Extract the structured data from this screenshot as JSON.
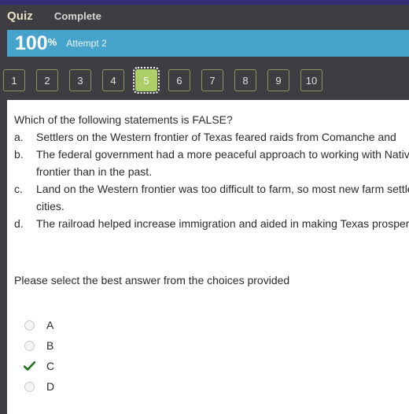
{
  "header": {
    "title": "Quiz",
    "status": "Complete"
  },
  "score_banner": {
    "value": "100",
    "percent_symbol": "%",
    "attempt": "Attempt 2"
  },
  "question_nav": {
    "items": [
      "1",
      "2",
      "3",
      "4",
      "5",
      "6",
      "7",
      "8",
      "9",
      "10"
    ],
    "active_index": 4
  },
  "question": {
    "stem": "Which of the following statements is FALSE?",
    "options": [
      {
        "letter": "a.",
        "text": "Settlers on the Western frontier of Texas feared raids from Comanche and"
      },
      {
        "letter": "b.",
        "text": "The federal government had a more peaceful approach to working with Native Americans on the Western frontier than in the past."
      },
      {
        "letter": "c.",
        "text": "Land on the Western frontier was too difficult to farm, so most new farm settlers gave up and moved to the cities."
      },
      {
        "letter": "d.",
        "text": "The railroad helped increase immigration and aided in making Texas prosperous."
      }
    ],
    "instruction": "Please select the best answer from the choices provided"
  },
  "answers": {
    "choices": [
      {
        "label": "A",
        "state": "unselected"
      },
      {
        "label": "B",
        "state": "unselected"
      },
      {
        "label": "C",
        "state": "checked"
      },
      {
        "label": "D",
        "state": "unselected"
      }
    ]
  },
  "colors": {
    "top_strip": "#342f7a",
    "header_bg": "#3e3e42",
    "banner_blue": "#45a3cc",
    "active_green": "#adcf68",
    "nav_border": "#8b9560",
    "check_green": "#207020"
  }
}
